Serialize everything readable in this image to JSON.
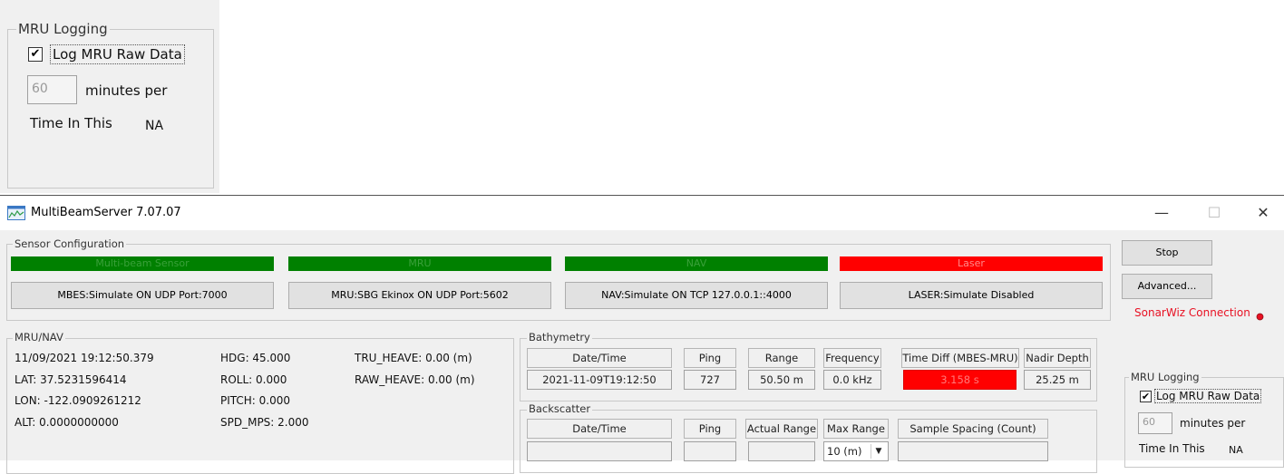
{
  "inset": {
    "group_title": "MRU Logging",
    "log_raw_label": "Log MRU Raw Data",
    "log_raw_checked": "✔",
    "minutes_value": "60",
    "minutes_label": "minutes per",
    "time_label": "Time In This",
    "time_value": "NA"
  },
  "window": {
    "title": "MultiBeamServer 7.07.07",
    "controls": {
      "minimize": "—",
      "maximize": "☐",
      "close": "✕"
    }
  },
  "sensor_config": {
    "title": "Sensor Configuration",
    "status": [
      {
        "label": "Multi-beam Sensor",
        "color": "#008000"
      },
      {
        "label": "MRU",
        "color": "#008000"
      },
      {
        "label": "NAV",
        "color": "#008000"
      },
      {
        "label": "Laser",
        "color": "#ff0000"
      }
    ],
    "buttons": [
      "MBES:Simulate ON UDP Port:7000",
      "MRU:SBG Ekinox ON UDP Port:5602",
      "NAV:Simulate ON TCP 127.0.0.1::4000",
      "LASER:Simulate Disabled"
    ]
  },
  "side": {
    "stop": "Stop",
    "advanced": "Advanced...",
    "sonarwiz": "SonarWiz Connection",
    "sonarwiz_color": "#e81123"
  },
  "mru_nav": {
    "title": "MRU/NAV",
    "col1": [
      "11/09/2021 19:12:50.379",
      "LAT: 37.5231596414",
      "LON: -122.0909261212",
      "ALT: 0.0000000000"
    ],
    "col2": [
      "HDG: 45.000",
      "ROLL: 0.000",
      "PITCH: 0.000",
      "SPD_MPS: 2.000"
    ],
    "col3": [
      "TRU_HEAVE: 0.00 (m)",
      "RAW_HEAVE: 0.00 (m)"
    ]
  },
  "bathymetry": {
    "title": "Bathymetry",
    "headers": [
      "Date/Time",
      "Ping",
      "Range",
      "Frequency",
      "Time Diff (MBES-MRU)",
      "Nadir Depth"
    ],
    "values": [
      "2021-11-09T19:12:50",
      "727",
      "50.50 m",
      "0.0 kHz",
      "3.158 s",
      "25.25 m"
    ],
    "alert_color": "#ff0000"
  },
  "backscatter": {
    "title": "Backscatter",
    "headers": [
      "Date/Time",
      "Ping",
      "Actual Range",
      "Max Range",
      "Sample Spacing (Count)"
    ],
    "max_range_value": "10 (m)"
  },
  "mru_logging": {
    "title": "MRU Logging",
    "log_raw_label": "Log MRU Raw Data",
    "log_raw_checked": "✔",
    "minutes_value": "60",
    "minutes_label": "minutes per",
    "time_label": "Time In This",
    "time_value": "NA"
  }
}
